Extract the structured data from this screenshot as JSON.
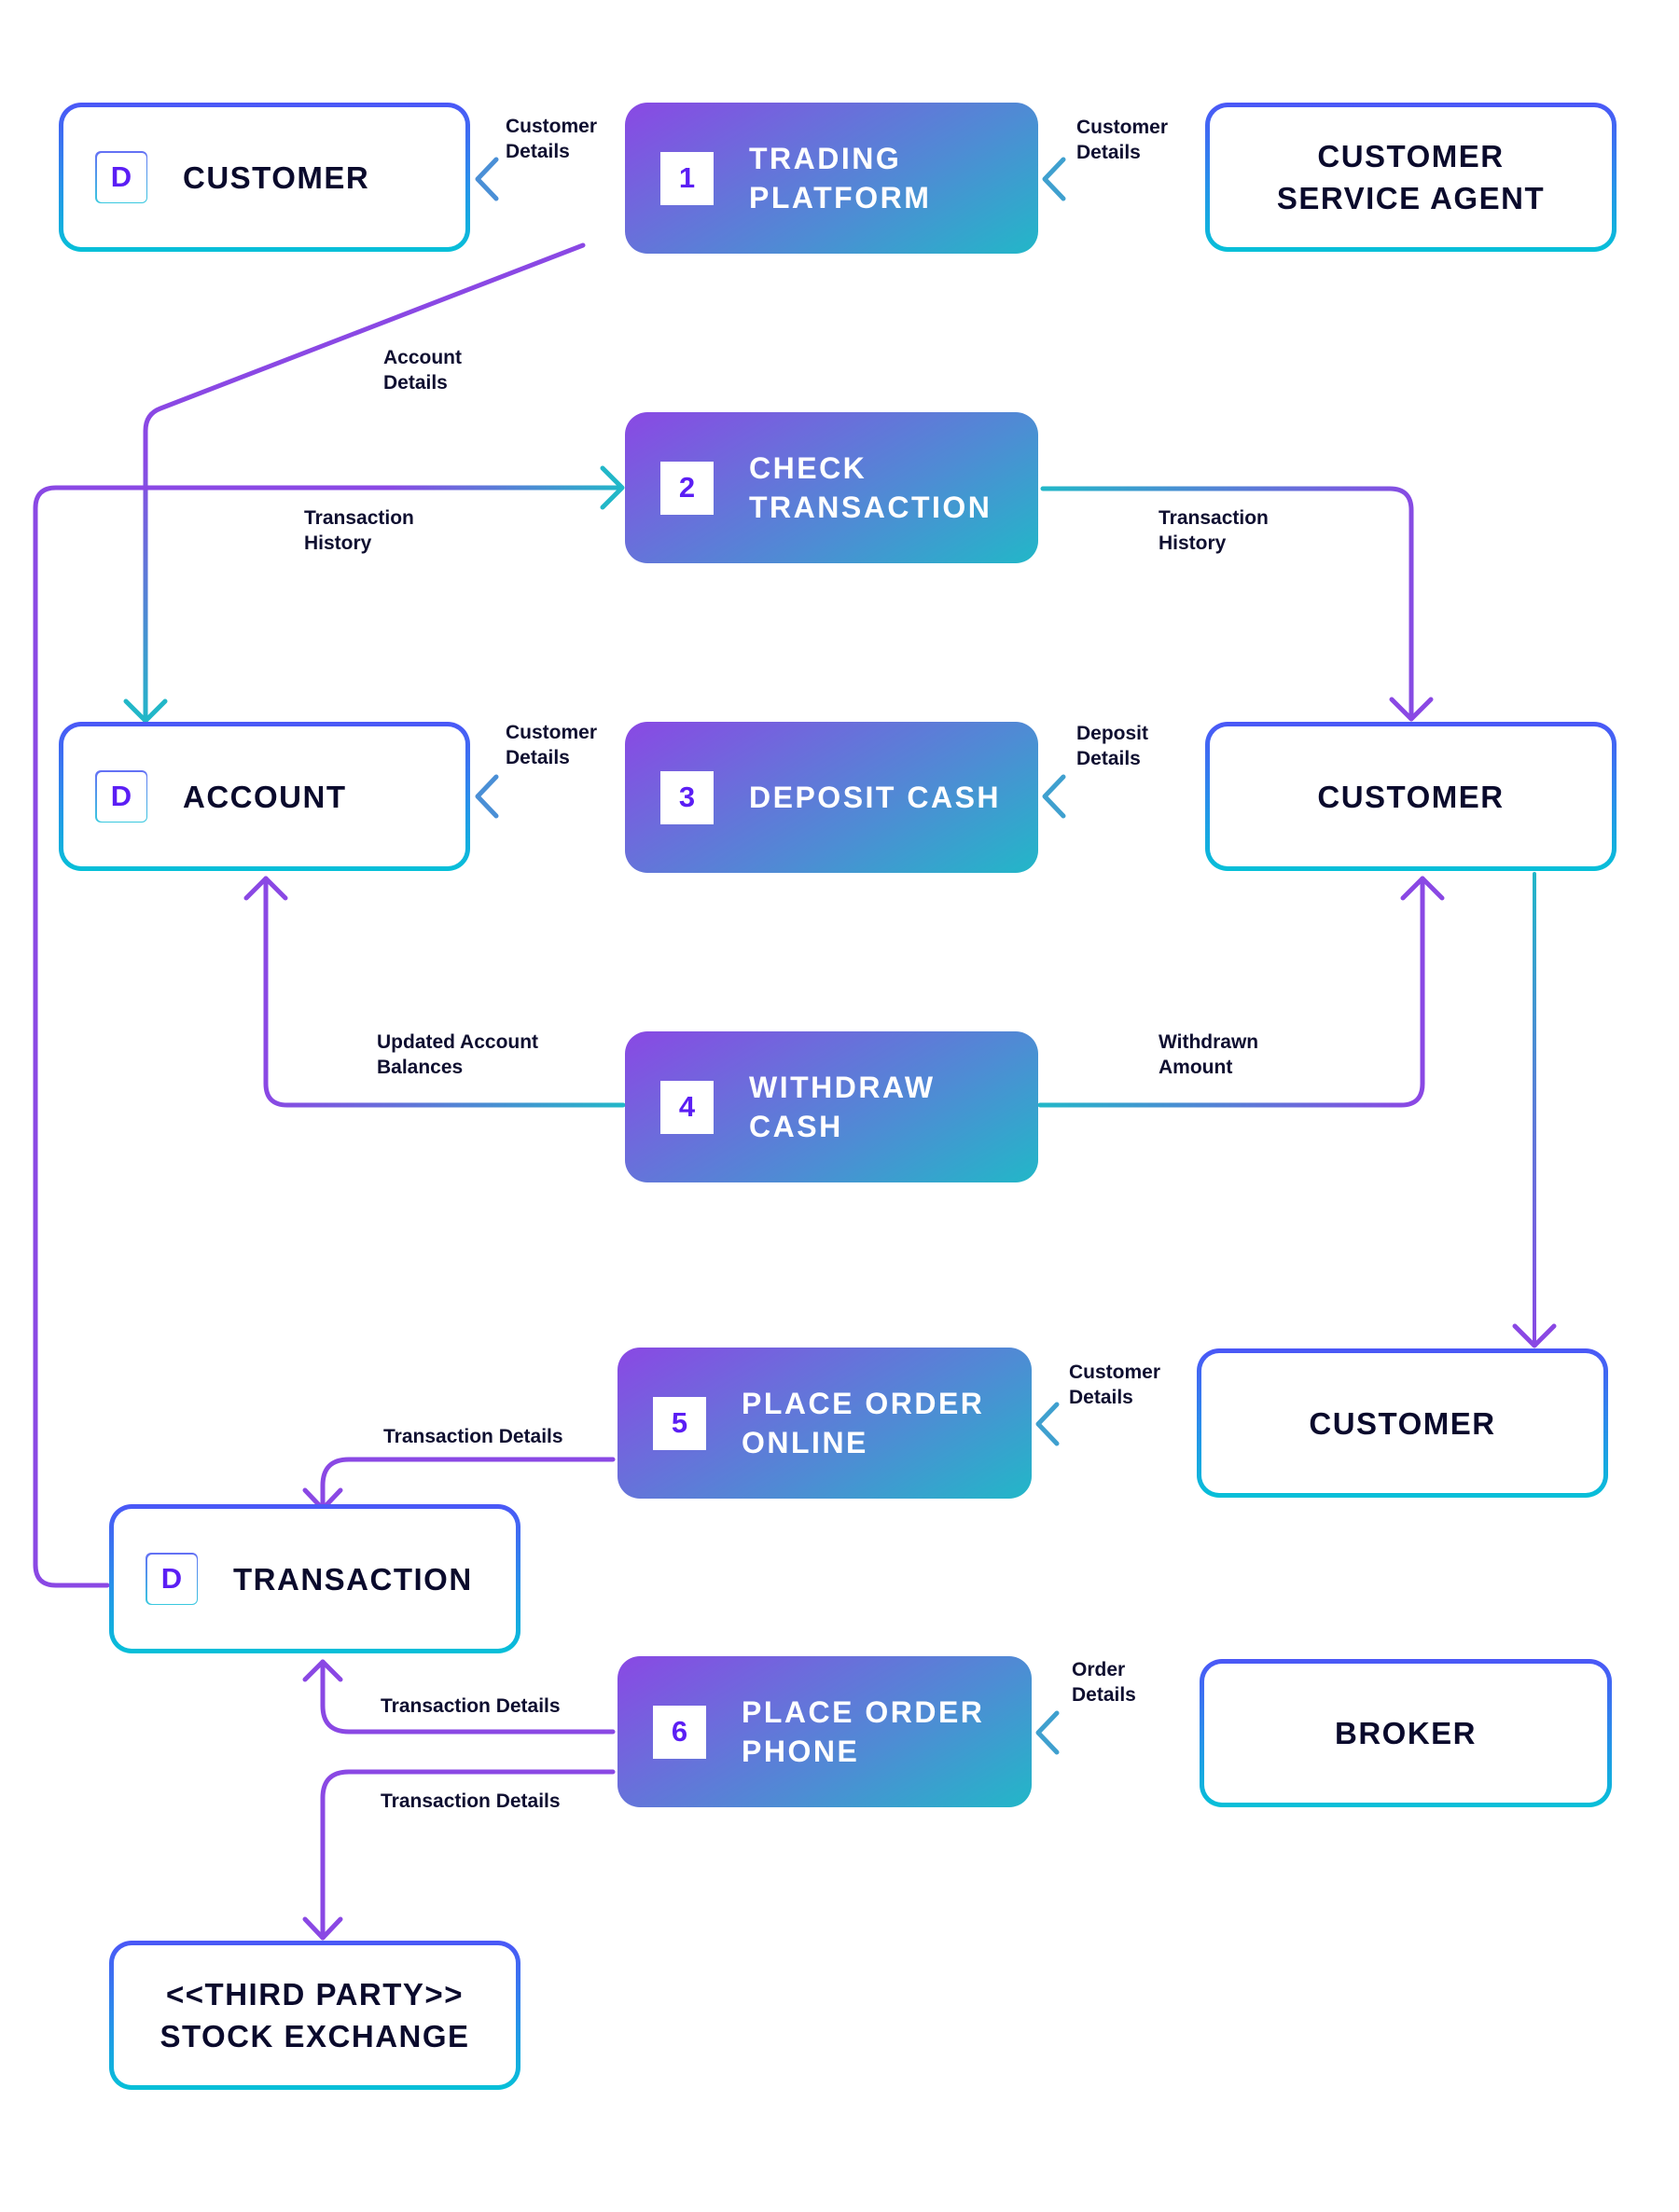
{
  "diagram": {
    "type": "data-flow-diagram",
    "colors": {
      "gradient_purple": "#8A48E4",
      "gradient_teal": "#22B7C8",
      "entity_border_top": "#4B57F7",
      "entity_border_bottom": "#06C0D8",
      "text_dark": "#0A0A2C",
      "number_purple": "#5B1EF4"
    },
    "data_store_icon": "D",
    "entities": {
      "customer_top": {
        "name": "CUSTOMER",
        "icon": "D"
      },
      "service_agent": {
        "name": "CUSTOMER\nSERVICE AGENT"
      },
      "account": {
        "name": "ACCOUNT",
        "icon": "D"
      },
      "customer_mid": {
        "name": "CUSTOMER"
      },
      "customer_low": {
        "name": "CUSTOMER"
      },
      "transaction": {
        "name": "TRANSACTION",
        "icon": "D"
      },
      "broker": {
        "name": "BROKER"
      },
      "stock_exchange": {
        "name": "<<THIRD PARTY>>\nSTOCK EXCHANGE"
      }
    },
    "processes": [
      {
        "number": "1",
        "title": "TRADING\nPLATFORM"
      },
      {
        "number": "2",
        "title": "CHECK\nTRANSACTION"
      },
      {
        "number": "3",
        "title": "DEPOSIT CASH"
      },
      {
        "number": "4",
        "title": "WITHDRAW\nCASH"
      },
      {
        "number": "5",
        "title": "PLACE ORDER\nONLINE"
      },
      {
        "number": "6",
        "title": "PLACE ORDER\nPHONE"
      }
    ],
    "flows": {
      "p1_to_customer": "Customer\nDetails",
      "agent_to_p1": "Customer\nDetails",
      "p1_to_account": "Account\nDetails",
      "transaction_to_p2": "Transaction\nHistory",
      "p2_to_customer": "Transaction\nHistory",
      "p3_to_account": "Customer\nDetails",
      "customer_to_p3": "Deposit\nDetails",
      "p4_to_account": "Updated Account\nBalances",
      "p4_to_customer": "Withdrawn\nAmount",
      "customer_to_p5": "Customer\nDetails",
      "p5_to_transaction": "Transaction Details",
      "p6_to_transaction": "Transaction Details",
      "p6_to_exchange": "Transaction Details",
      "broker_to_p6": "Order\nDetails"
    }
  }
}
